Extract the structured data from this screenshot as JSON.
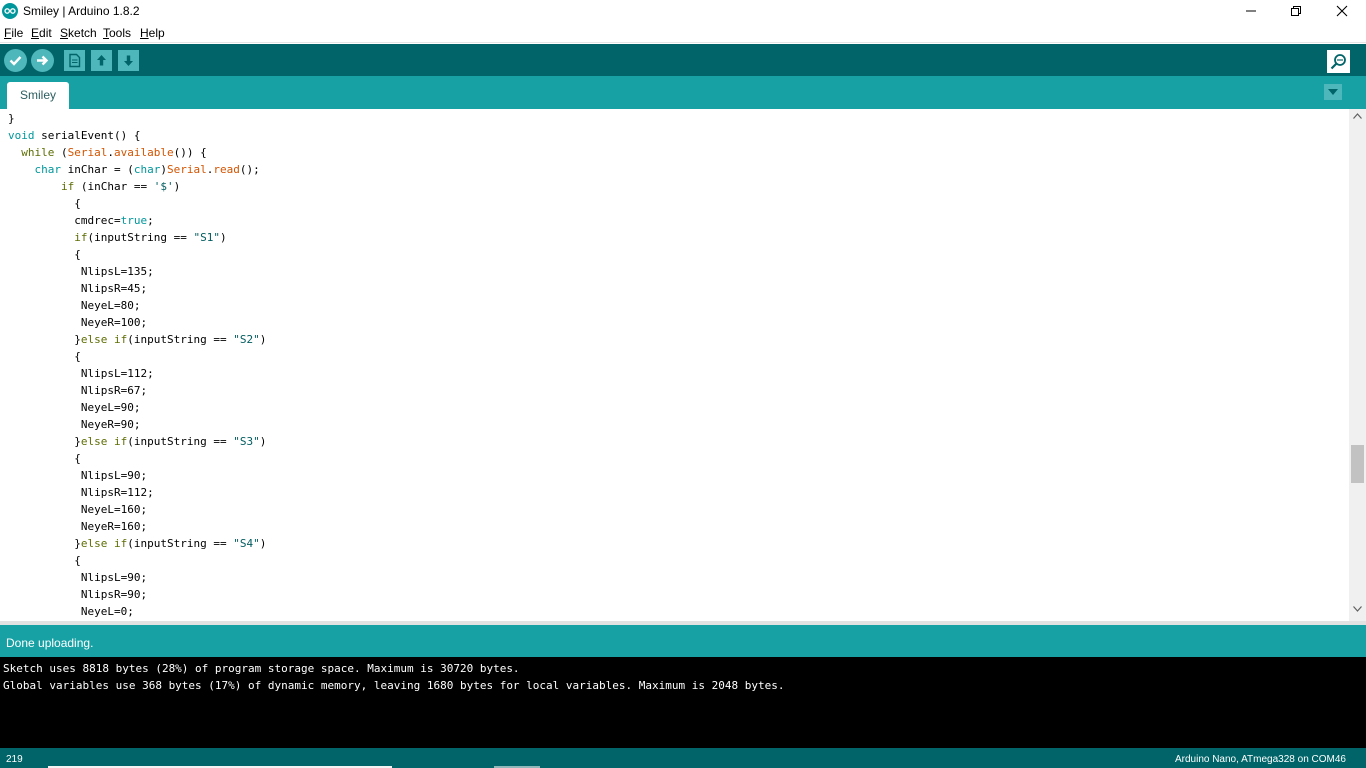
{
  "window": {
    "title": "Smiley | Arduino 1.8.2",
    "minimize_icon": "minimize-icon",
    "maximize_icon": "restore-icon",
    "close_icon": "close-icon"
  },
  "menu": [
    "File",
    "Edit",
    "Sketch",
    "Tools",
    "Help"
  ],
  "toolbar": {
    "buttons": [
      "verify-icon",
      "upload-icon",
      "new-icon",
      "open-icon",
      "save-icon"
    ],
    "serial_monitor_icon": "serial-monitor-icon"
  },
  "tabs": [
    {
      "label": "Smiley",
      "active": true
    }
  ],
  "tab_menu_icon": "chevron-down-icon",
  "code_lines": [
    "}",
    "void serialEvent() {",
    "  while (Serial.available()) {",
    "    char inChar = (char)Serial.read();",
    "        if (inChar == '$')",
    "          {",
    "          cmdrec=true;",
    "          if(inputString == \"S1\")",
    "          {",
    "           NlipsL=135;",
    "           NlipsR=45;",
    "           NeyeL=80;",
    "           NeyeR=100;",
    "          }else if(inputString == \"S2\")",
    "          {",
    "           NlipsL=112;",
    "           NlipsR=67;",
    "           NeyeL=90;",
    "           NeyeR=90;",
    "          }else if(inputString == \"S3\")",
    "          {",
    "           NlipsL=90;",
    "           NlipsR=112;",
    "           NeyeL=160;",
    "           NeyeR=160;",
    "          }else if(inputString == \"S4\")",
    "          {",
    "           NlipsL=90;",
    "           NlipsR=90;",
    "           NeyeL=0;"
  ],
  "status": {
    "message": "Done uploading."
  },
  "console": [
    "Sketch uses 8818 bytes (28%) of program storage space. Maximum is 30720 bytes.",
    "Global variables use 368 bytes (17%) of dynamic memory, leaving 1680 bytes for local variables. Maximum is 2048 bytes."
  ],
  "footer": {
    "line_number": "219",
    "board": "Arduino Nano, ATmega328 on COM46"
  },
  "colors": {
    "toolbar": "#006468",
    "tabbar": "#17a1a5",
    "button": "#4db7bb",
    "keyword": "#5e6d03",
    "type": "#00979c",
    "function": "#d35400",
    "string": "#005c5f"
  }
}
